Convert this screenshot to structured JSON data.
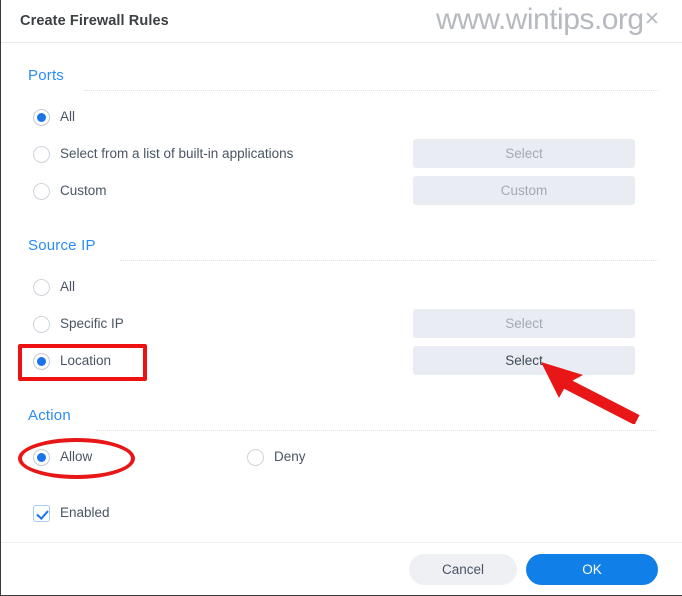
{
  "dialog": {
    "title": "Create Firewall Rules",
    "close_icon": "close-icon"
  },
  "watermark": {
    "text": "www.wintips.org"
  },
  "sections": [
    {
      "id": "ports",
      "heading": "Ports",
      "options": [
        {
          "label": "All",
          "selected": true
        },
        {
          "label": "Select from a list of built-in applications",
          "selected": false
        },
        {
          "label": "Custom",
          "selected": false
        }
      ],
      "buttons": [
        {
          "label": "Select",
          "enabled": false
        },
        {
          "label": "Custom",
          "enabled": false
        }
      ]
    },
    {
      "id": "source-ip",
      "heading": "Source IP",
      "options": [
        {
          "label": "All",
          "selected": false
        },
        {
          "label": "Specific IP",
          "selected": false
        },
        {
          "label": "Location",
          "selected": true
        }
      ],
      "buttons": [
        {
          "label": "Select",
          "enabled": false
        },
        {
          "label": "Select",
          "enabled": true
        }
      ]
    },
    {
      "id": "action",
      "heading": "Action",
      "options": [
        {
          "label": "Allow",
          "selected": true
        },
        {
          "label": "Deny",
          "selected": false
        }
      ]
    }
  ],
  "enabled_checkbox": {
    "label": "Enabled",
    "checked": true
  },
  "footer": {
    "cancel_label": "Cancel",
    "ok_label": "OK"
  },
  "colors": {
    "accent": "#1a73e8",
    "section_heading": "#2a8cf7",
    "annotation": "#ee1111",
    "ok_button": "#1080e8"
  }
}
